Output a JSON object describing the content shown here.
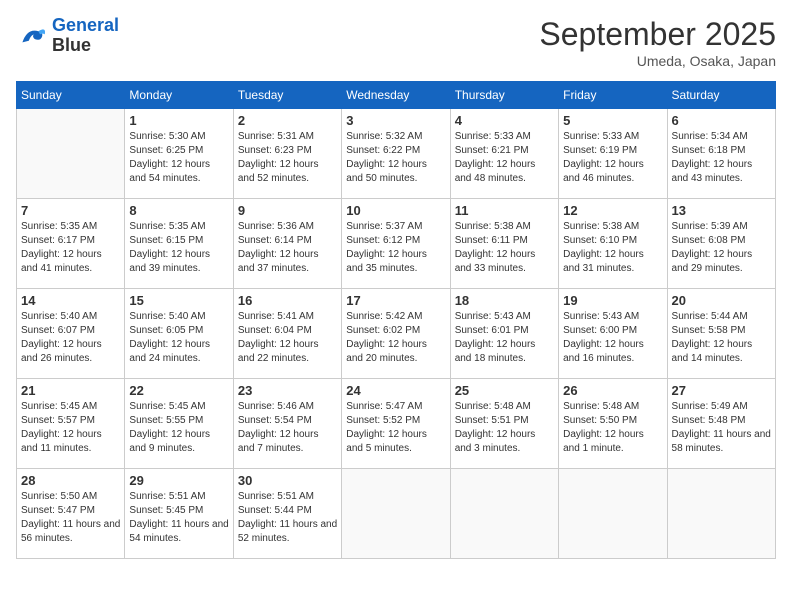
{
  "header": {
    "logo_line1": "General",
    "logo_line2": "Blue",
    "month": "September 2025",
    "location": "Umeda, Osaka, Japan"
  },
  "weekdays": [
    "Sunday",
    "Monday",
    "Tuesday",
    "Wednesday",
    "Thursday",
    "Friday",
    "Saturday"
  ],
  "weeks": [
    [
      {
        "day": "",
        "sunrise": "",
        "sunset": "",
        "daylight": ""
      },
      {
        "day": "1",
        "sunrise": "5:30 AM",
        "sunset": "6:25 PM",
        "daylight": "12 hours and 54 minutes."
      },
      {
        "day": "2",
        "sunrise": "5:31 AM",
        "sunset": "6:23 PM",
        "daylight": "12 hours and 52 minutes."
      },
      {
        "day": "3",
        "sunrise": "5:32 AM",
        "sunset": "6:22 PM",
        "daylight": "12 hours and 50 minutes."
      },
      {
        "day": "4",
        "sunrise": "5:33 AM",
        "sunset": "6:21 PM",
        "daylight": "12 hours and 48 minutes."
      },
      {
        "day": "5",
        "sunrise": "5:33 AM",
        "sunset": "6:19 PM",
        "daylight": "12 hours and 46 minutes."
      },
      {
        "day": "6",
        "sunrise": "5:34 AM",
        "sunset": "6:18 PM",
        "daylight": "12 hours and 43 minutes."
      }
    ],
    [
      {
        "day": "7",
        "sunrise": "5:35 AM",
        "sunset": "6:17 PM",
        "daylight": "12 hours and 41 minutes."
      },
      {
        "day": "8",
        "sunrise": "5:35 AM",
        "sunset": "6:15 PM",
        "daylight": "12 hours and 39 minutes."
      },
      {
        "day": "9",
        "sunrise": "5:36 AM",
        "sunset": "6:14 PM",
        "daylight": "12 hours and 37 minutes."
      },
      {
        "day": "10",
        "sunrise": "5:37 AM",
        "sunset": "6:12 PM",
        "daylight": "12 hours and 35 minutes."
      },
      {
        "day": "11",
        "sunrise": "5:38 AM",
        "sunset": "6:11 PM",
        "daylight": "12 hours and 33 minutes."
      },
      {
        "day": "12",
        "sunrise": "5:38 AM",
        "sunset": "6:10 PM",
        "daylight": "12 hours and 31 minutes."
      },
      {
        "day": "13",
        "sunrise": "5:39 AM",
        "sunset": "6:08 PM",
        "daylight": "12 hours and 29 minutes."
      }
    ],
    [
      {
        "day": "14",
        "sunrise": "5:40 AM",
        "sunset": "6:07 PM",
        "daylight": "12 hours and 26 minutes."
      },
      {
        "day": "15",
        "sunrise": "5:40 AM",
        "sunset": "6:05 PM",
        "daylight": "12 hours and 24 minutes."
      },
      {
        "day": "16",
        "sunrise": "5:41 AM",
        "sunset": "6:04 PM",
        "daylight": "12 hours and 22 minutes."
      },
      {
        "day": "17",
        "sunrise": "5:42 AM",
        "sunset": "6:02 PM",
        "daylight": "12 hours and 20 minutes."
      },
      {
        "day": "18",
        "sunrise": "5:43 AM",
        "sunset": "6:01 PM",
        "daylight": "12 hours and 18 minutes."
      },
      {
        "day": "19",
        "sunrise": "5:43 AM",
        "sunset": "6:00 PM",
        "daylight": "12 hours and 16 minutes."
      },
      {
        "day": "20",
        "sunrise": "5:44 AM",
        "sunset": "5:58 PM",
        "daylight": "12 hours and 14 minutes."
      }
    ],
    [
      {
        "day": "21",
        "sunrise": "5:45 AM",
        "sunset": "5:57 PM",
        "daylight": "12 hours and 11 minutes."
      },
      {
        "day": "22",
        "sunrise": "5:45 AM",
        "sunset": "5:55 PM",
        "daylight": "12 hours and 9 minutes."
      },
      {
        "day": "23",
        "sunrise": "5:46 AM",
        "sunset": "5:54 PM",
        "daylight": "12 hours and 7 minutes."
      },
      {
        "day": "24",
        "sunrise": "5:47 AM",
        "sunset": "5:52 PM",
        "daylight": "12 hours and 5 minutes."
      },
      {
        "day": "25",
        "sunrise": "5:48 AM",
        "sunset": "5:51 PM",
        "daylight": "12 hours and 3 minutes."
      },
      {
        "day": "26",
        "sunrise": "5:48 AM",
        "sunset": "5:50 PM",
        "daylight": "12 hours and 1 minute."
      },
      {
        "day": "27",
        "sunrise": "5:49 AM",
        "sunset": "5:48 PM",
        "daylight": "11 hours and 58 minutes."
      }
    ],
    [
      {
        "day": "28",
        "sunrise": "5:50 AM",
        "sunset": "5:47 PM",
        "daylight": "11 hours and 56 minutes."
      },
      {
        "day": "29",
        "sunrise": "5:51 AM",
        "sunset": "5:45 PM",
        "daylight": "11 hours and 54 minutes."
      },
      {
        "day": "30",
        "sunrise": "5:51 AM",
        "sunset": "5:44 PM",
        "daylight": "11 hours and 52 minutes."
      },
      {
        "day": "",
        "sunrise": "",
        "sunset": "",
        "daylight": ""
      },
      {
        "day": "",
        "sunrise": "",
        "sunset": "",
        "daylight": ""
      },
      {
        "day": "",
        "sunrise": "",
        "sunset": "",
        "daylight": ""
      },
      {
        "day": "",
        "sunrise": "",
        "sunset": "",
        "daylight": ""
      }
    ]
  ]
}
